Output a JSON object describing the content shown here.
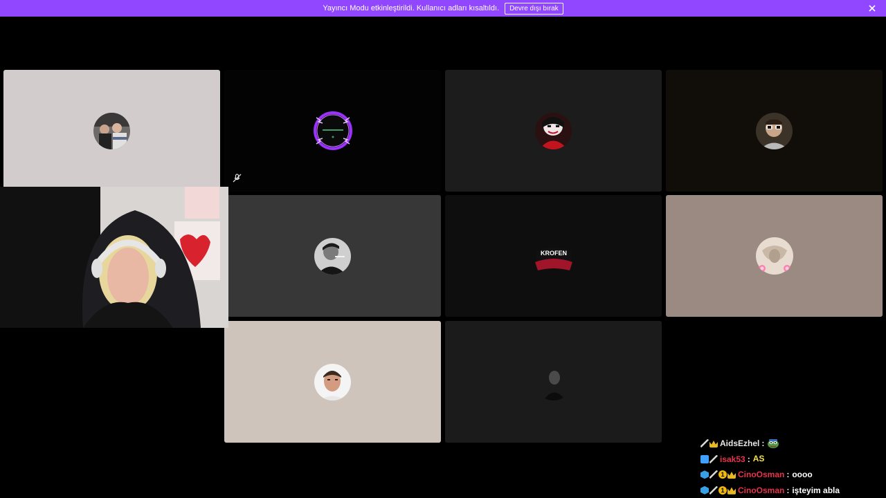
{
  "banner": {
    "message": "Yayıncı Modu etkinleştirildi. Kullanıcı adları kısaltıldı.",
    "button_label": "Devre dışı bırak",
    "color": "#9147ff"
  },
  "grid": {
    "tiles": [
      {
        "id": "t1",
        "background": "#d2cccd"
      },
      {
        "id": "t2",
        "background": "#030303"
      },
      {
        "id": "t3",
        "background": "#1d1c1d"
      },
      {
        "id": "t4",
        "background": "#110e0a"
      },
      {
        "id": "t5",
        "background": "#373737"
      },
      {
        "id": "t6",
        "background": "#0e0e0e",
        "avatar_text": "KROFEN"
      },
      {
        "id": "t7",
        "background": "#9a8a81"
      },
      {
        "id": "t8",
        "background": "#cec4bb"
      },
      {
        "id": "t9",
        "background": "#1b1b1b"
      }
    ]
  },
  "icons": {
    "muted_mic": "mic-muted-icon",
    "close": "close-icon"
  },
  "chat": {
    "messages": [
      {
        "user": "AidsEzhel",
        "user_color": "#e8e8e8",
        "separator": ":",
        "text": "",
        "emote": "pepe-emote",
        "badges": [
          "sword",
          "crown"
        ]
      },
      {
        "user": "isak53",
        "user_color": "#e5334b",
        "separator": ":",
        "text": "",
        "emote": "as-emote",
        "emote_text": "AS",
        "badges": [
          "blue",
          "sword"
        ]
      },
      {
        "user": "CinoOsman",
        "user_color": "#e5334b",
        "separator": ":",
        "text": "oooo",
        "badges": [
          "cube",
          "sword",
          "coin",
          "crown"
        ]
      },
      {
        "user": "CinoOsman",
        "user_color": "#e5334b",
        "separator": ":",
        "text": "işteyim abla",
        "badges": [
          "cube",
          "sword",
          "coin",
          "crown"
        ]
      }
    ]
  }
}
